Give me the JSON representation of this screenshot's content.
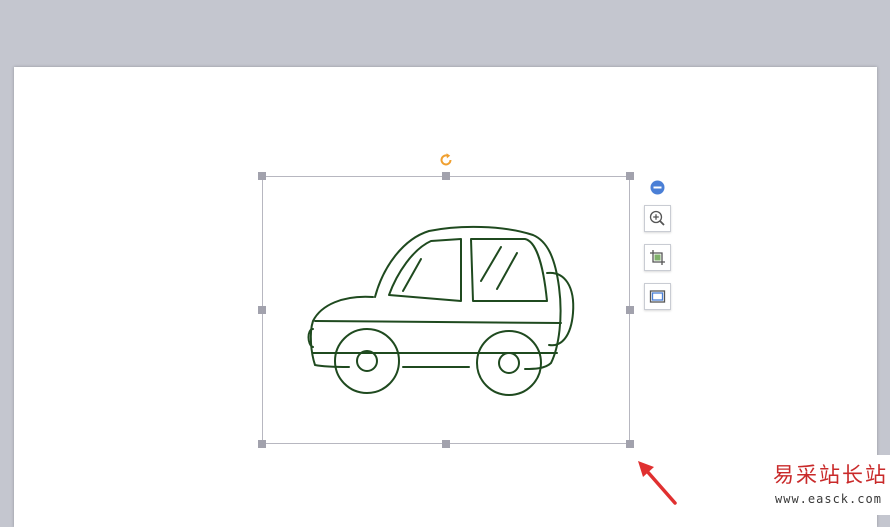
{
  "document": {
    "background_color": "#c4c6cf",
    "page_color": "#ffffff"
  },
  "selected_image": {
    "content": "car-line-drawing",
    "stroke_color": "#1f4a1f",
    "handle_color": "#a2a2ad",
    "rotate_icon": "rotate-icon",
    "rotate_color": "#f0a030"
  },
  "float_toolbar": {
    "collapse_icon": "minus-circle-icon",
    "collapse_color": "#4a7fd6",
    "buttons": [
      {
        "icon": "zoom-in-icon"
      },
      {
        "icon": "crop-image-icon"
      },
      {
        "icon": "border-frame-icon"
      }
    ]
  },
  "annotation": {
    "arrow_color": "#e03030"
  },
  "watermark": {
    "title": "易采站长站",
    "url": "www.easck.com"
  }
}
